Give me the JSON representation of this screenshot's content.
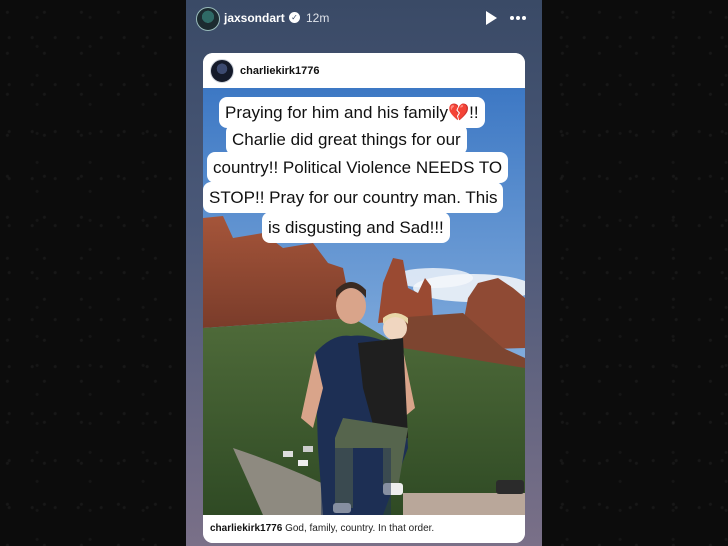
{
  "story": {
    "username": "jaxsondart",
    "time": "12m"
  },
  "post": {
    "username": "charliekirk1776",
    "caption_user": "charliekirk1776",
    "caption_text": "God, family, country. In that order."
  },
  "overlay": {
    "lines": [
      "Praying for him and his family💔!!",
      "Charlie did great things for our",
      "country!! Political Violence NEEDS TO",
      "STOP!! Pray for our country man. This",
      "is disgusting and Sad!!!"
    ]
  },
  "colors": {
    "story_bg": "#3a4a66",
    "overlay_bg": "#ffffff"
  },
  "icons": [
    "verified-icon",
    "play-icon",
    "more-icon"
  ]
}
